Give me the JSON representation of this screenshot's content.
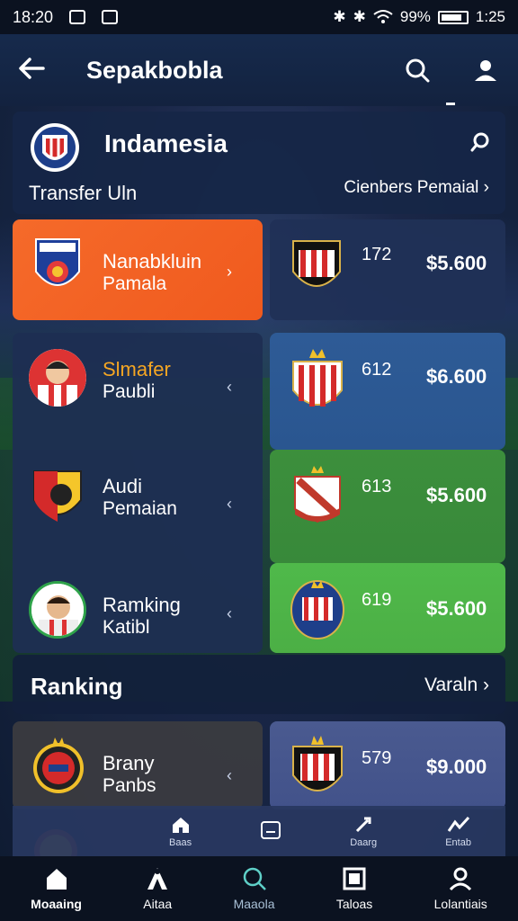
{
  "status_bar": {
    "time_left": "18:20",
    "battery_pct": "99%",
    "time_right": "1:25"
  },
  "app_bar": {
    "title": "Sepakbobla"
  },
  "header": {
    "title": "Indamesia",
    "sub_left": "Transfer Uln",
    "sub_right": "Cienbers Pemaial"
  },
  "rows": [
    {
      "name": "Nanabkluin",
      "sub": "Pamala",
      "number": "172",
      "price": "$5.600"
    },
    {
      "name": "Slmafer",
      "sub": "Paubli",
      "number": "612",
      "price": "$6.600"
    },
    {
      "name": "Audi",
      "sub": "Pemaian",
      "number": "613",
      "price": "$5.600"
    },
    {
      "name": "Ramking",
      "sub": "Katibl",
      "number": "619",
      "price": "$5.600"
    }
  ],
  "ranking": {
    "title": "Ranking",
    "link": "Varaln",
    "row": {
      "name": "Brany",
      "sub": "Panbs",
      "number": "579",
      "price": "$9.000"
    }
  },
  "mini_nav": [
    "Baas",
    "",
    "Daarg",
    "Entab"
  ],
  "bottom_nav": [
    {
      "label": "Moaaing",
      "icon": "home-icon"
    },
    {
      "label": "Aitaa",
      "icon": "person-a-icon"
    },
    {
      "label": "Maaola",
      "icon": "search-icon"
    },
    {
      "label": "Taloas",
      "icon": "tablet-icon"
    },
    {
      "label": "Lolantiais",
      "icon": "user-icon"
    }
  ],
  "colors": {
    "accent_orange": "#F05A1E",
    "panel_blue": "#2A5690",
    "panel_green": "#38893A",
    "panel_light_green": "#4CAF45",
    "highlight_gold": "#F5A623"
  }
}
